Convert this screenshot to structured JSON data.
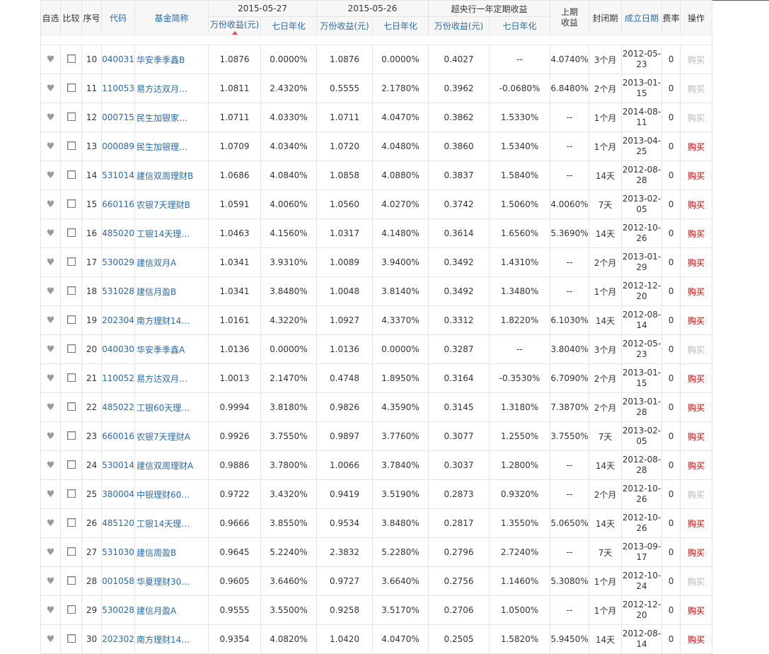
{
  "header": {
    "fav": "自选",
    "compare": "比较",
    "index": "序号",
    "code": "代码",
    "name": "基金简称",
    "date1": "2015-05-27",
    "date2": "2015-05-26",
    "exceed": "超央行一年定期收益",
    "prev_return_line1": "上期",
    "prev_return_line2": "收益",
    "lock_period": "封闭期",
    "inception": "成立日期",
    "fee": "费率",
    "action": "操作",
    "wan_income": "万份收益(元)",
    "seven_day": "七日年化"
  },
  "rows": [
    {
      "idx": "10",
      "code": "040031",
      "name": "华安季季鑫B",
      "w1": "1.0876",
      "s1": "0.0000%",
      "w2": "1.0876",
      "s2": "0.0000%",
      "ew": "0.4027",
      "es": "--",
      "prev": "4.0740%",
      "lock": "3个月",
      "date": "2012-05-23",
      "fee": "0",
      "buy": "购买",
      "buy_on": false
    },
    {
      "idx": "11",
      "code": "110053",
      "name": "易方达双月…",
      "w1": "1.0811",
      "s1": "2.4320%",
      "w2": "0.5555",
      "s2": "2.1780%",
      "ew": "0.3962",
      "es": "-0.0680%",
      "prev": "6.8480%",
      "lock": "2个月",
      "date": "2013-01-15",
      "fee": "0",
      "buy": "购买",
      "buy_on": false
    },
    {
      "idx": "12",
      "code": "000715",
      "name": "民生加银家…",
      "w1": "1.0711",
      "s1": "4.0330%",
      "w2": "1.0711",
      "s2": "4.0470%",
      "ew": "0.3862",
      "es": "1.5330%",
      "prev": "--",
      "lock": "1个月",
      "date": "2014-08-11",
      "fee": "0",
      "buy": "购买",
      "buy_on": false
    },
    {
      "idx": "13",
      "code": "000089",
      "name": "民生加银理…",
      "w1": "1.0709",
      "s1": "4.0340%",
      "w2": "1.0720",
      "s2": "4.0480%",
      "ew": "0.3860",
      "es": "1.5340%",
      "prev": "--",
      "lock": "1个月",
      "date": "2013-04-25",
      "fee": "0",
      "buy": "购买",
      "buy_on": true
    },
    {
      "idx": "14",
      "code": "531014",
      "name": "建信双周理财B",
      "w1": "1.0686",
      "s1": "4.0840%",
      "w2": "1.0858",
      "s2": "4.0880%",
      "ew": "0.3837",
      "es": "1.5840%",
      "prev": "--",
      "lock": "14天",
      "date": "2012-08-28",
      "fee": "0",
      "buy": "购买",
      "buy_on": true
    },
    {
      "idx": "15",
      "code": "660116",
      "name": "农银7天理财B",
      "w1": "1.0591",
      "s1": "4.0060%",
      "w2": "1.0560",
      "s2": "4.0270%",
      "ew": "0.3742",
      "es": "1.5060%",
      "prev": "4.0060%",
      "lock": "7天",
      "date": "2013-02-05",
      "fee": "0",
      "buy": "购买",
      "buy_on": true
    },
    {
      "idx": "16",
      "code": "485020",
      "name": "工银14天理…",
      "w1": "1.0463",
      "s1": "4.1560%",
      "w2": "1.0317",
      "s2": "4.1480%",
      "ew": "0.3614",
      "es": "1.6560%",
      "prev": "5.3690%",
      "lock": "14天",
      "date": "2012-10-26",
      "fee": "0",
      "buy": "购买",
      "buy_on": true
    },
    {
      "idx": "17",
      "code": "530029",
      "name": "建信双月A",
      "w1": "1.0341",
      "s1": "3.9310%",
      "w2": "1.0089",
      "s2": "3.9400%",
      "ew": "0.3492",
      "es": "1.4310%",
      "prev": "--",
      "lock": "2个月",
      "date": "2013-01-29",
      "fee": "0",
      "buy": "购买",
      "buy_on": true
    },
    {
      "idx": "18",
      "code": "531028",
      "name": "建信月盈B",
      "w1": "1.0341",
      "s1": "3.8480%",
      "w2": "1.0048",
      "s2": "3.8140%",
      "ew": "0.3492",
      "es": "1.3480%",
      "prev": "--",
      "lock": "1个月",
      "date": "2012-12-20",
      "fee": "0",
      "buy": "购买",
      "buy_on": true
    },
    {
      "idx": "19",
      "code": "202304",
      "name": "南方理财14…",
      "w1": "1.0161",
      "s1": "4.3220%",
      "w2": "1.0927",
      "s2": "4.3370%",
      "ew": "0.3312",
      "es": "1.8220%",
      "prev": "6.1030%",
      "lock": "14天",
      "date": "2012-08-14",
      "fee": "0",
      "buy": "购买",
      "buy_on": true
    },
    {
      "idx": "20",
      "code": "040030",
      "name": "华安季季鑫A",
      "w1": "1.0136",
      "s1": "0.0000%",
      "w2": "1.0136",
      "s2": "0.0000%",
      "ew": "0.3287",
      "es": "--",
      "prev": "3.8040%",
      "lock": "3个月",
      "date": "2012-05-23",
      "fee": "0",
      "buy": "购买",
      "buy_on": false
    },
    {
      "idx": "21",
      "code": "110052",
      "name": "易方达双月…",
      "w1": "1.0013",
      "s1": "2.1470%",
      "w2": "0.4748",
      "s2": "1.8950%",
      "ew": "0.3164",
      "es": "-0.3530%",
      "prev": "6.7090%",
      "lock": "2个月",
      "date": "2013-01-15",
      "fee": "0",
      "buy": "购买",
      "buy_on": true
    },
    {
      "idx": "22",
      "code": "485022",
      "name": "工银60天理…",
      "w1": "0.9994",
      "s1": "3.8180%",
      "w2": "0.9826",
      "s2": "4.3590%",
      "ew": "0.3145",
      "es": "1.3180%",
      "prev": "7.3870%",
      "lock": "2个月",
      "date": "2013-01-28",
      "fee": "0",
      "buy": "购买",
      "buy_on": true
    },
    {
      "idx": "23",
      "code": "660016",
      "name": "农银7天理财A",
      "w1": "0.9926",
      "s1": "3.7550%",
      "w2": "0.9897",
      "s2": "3.7760%",
      "ew": "0.3077",
      "es": "1.2550%",
      "prev": "3.7550%",
      "lock": "7天",
      "date": "2013-02-05",
      "fee": "0",
      "buy": "购买",
      "buy_on": true
    },
    {
      "idx": "24",
      "code": "530014",
      "name": "建信双周理财A",
      "w1": "0.9886",
      "s1": "3.7800%",
      "w2": "1.0066",
      "s2": "3.7840%",
      "ew": "0.3037",
      "es": "1.2800%",
      "prev": "--",
      "lock": "14天",
      "date": "2012-08-28",
      "fee": "0",
      "buy": "购买",
      "buy_on": true
    },
    {
      "idx": "25",
      "code": "380004",
      "name": "中银理财60…",
      "w1": "0.9722",
      "s1": "3.4320%",
      "w2": "0.9419",
      "s2": "3.5190%",
      "ew": "0.2873",
      "es": "0.9320%",
      "prev": "--",
      "lock": "2个月",
      "date": "2012-10-26",
      "fee": "0",
      "buy": "购买",
      "buy_on": false
    },
    {
      "idx": "26",
      "code": "485120",
      "name": "工银14天理…",
      "w1": "0.9666",
      "s1": "3.8550%",
      "w2": "0.9534",
      "s2": "3.8480%",
      "ew": "0.2817",
      "es": "1.3550%",
      "prev": "5.0650%",
      "lock": "14天",
      "date": "2012-10-26",
      "fee": "0",
      "buy": "购买",
      "buy_on": true
    },
    {
      "idx": "27",
      "code": "531030",
      "name": "建信周盈B",
      "w1": "0.9645",
      "s1": "5.2240%",
      "w2": "2.3832",
      "s2": "5.2280%",
      "ew": "0.2796",
      "es": "2.7240%",
      "prev": "--",
      "lock": "7天",
      "date": "2013-09-17",
      "fee": "0",
      "buy": "购买",
      "buy_on": true
    },
    {
      "idx": "28",
      "code": "001058",
      "name": "华夏理财30…",
      "w1": "0.9605",
      "s1": "3.6460%",
      "w2": "0.9727",
      "s2": "3.6640%",
      "ew": "0.2756",
      "es": "1.1460%",
      "prev": "5.3080%",
      "lock": "1个月",
      "date": "2012-10-24",
      "fee": "0",
      "buy": "购买",
      "buy_on": false
    },
    {
      "idx": "29",
      "code": "530028",
      "name": "建信月盈A",
      "w1": "0.9555",
      "s1": "3.5500%",
      "w2": "0.9258",
      "s2": "3.5170%",
      "ew": "0.2706",
      "es": "1.0500%",
      "prev": "--",
      "lock": "1个月",
      "date": "2012-12-20",
      "fee": "0",
      "buy": "购买",
      "buy_on": true
    },
    {
      "idx": "30",
      "code": "202302",
      "name": "南方理财14…",
      "w1": "0.9354",
      "s1": "4.0820%",
      "w2": "1.0420",
      "s2": "4.0470%",
      "ew": "0.2505",
      "es": "1.5820%",
      "prev": "5.9450%",
      "lock": "14天",
      "date": "2012-08-14",
      "fee": "0",
      "buy": "购买",
      "buy_on": true
    }
  ],
  "colors": {
    "link": "#2a6aa8",
    "buy_active": "#c40000",
    "buy_inactive": "#b5b5b5",
    "sort_arrow": "#d9534f"
  }
}
